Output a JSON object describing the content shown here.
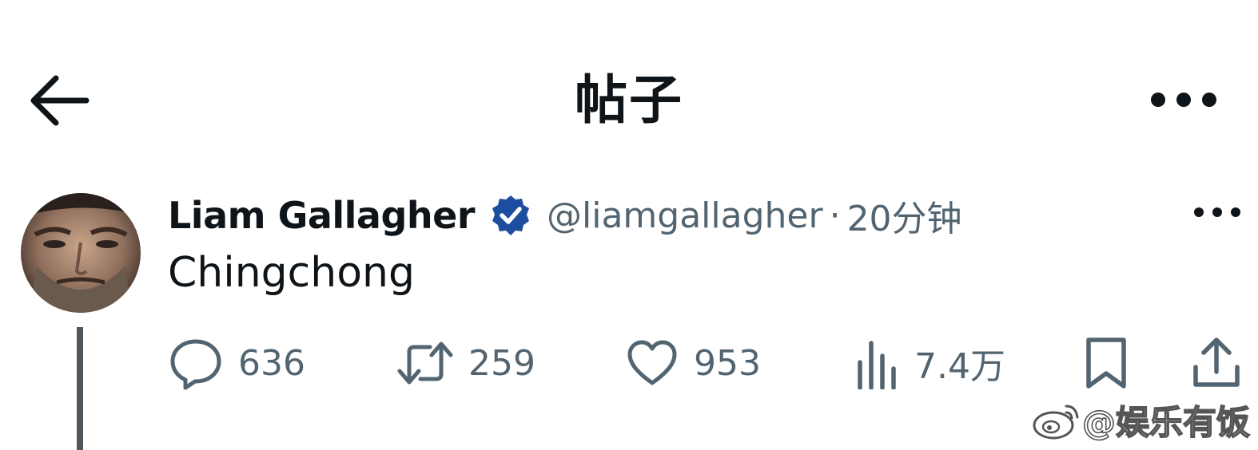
{
  "header": {
    "title": "帖子",
    "back_icon": "arrow-left-icon",
    "more_icon": "more-horizontal-icon"
  },
  "post": {
    "author_name": "Liam Gallagher",
    "verified_icon": "verified-badge-icon",
    "verified_color": "#1d4d9e",
    "handle": "@liamgallagher",
    "separator": "·",
    "time": "20分钟",
    "text": "Chingchong",
    "more_icon": "more-horizontal-icon"
  },
  "actions": {
    "replies": "636",
    "reposts": "259",
    "likes": "953",
    "views": "7.4万",
    "bookmark_icon": "bookmark-icon",
    "share_icon": "share-icon"
  },
  "watermark": {
    "text": "@娱乐有饭",
    "icon": "weibo-logo-icon"
  },
  "colors": {
    "text_primary": "#0f1419",
    "text_secondary": "#536471",
    "thread_line": "#4f565c"
  }
}
